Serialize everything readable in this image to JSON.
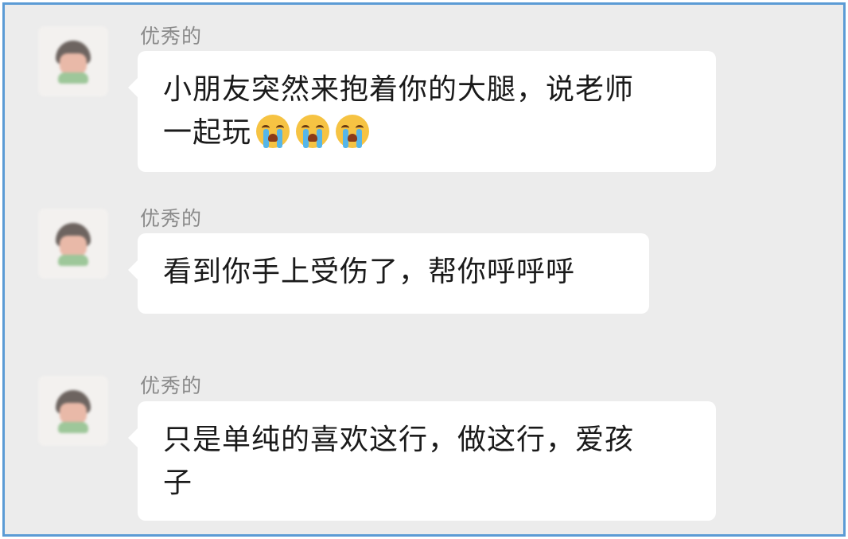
{
  "messages": [
    {
      "sender": "优秀的",
      "text_line1": "小朋友突然来抱着你的大腿，说老师",
      "text_line2": "一起玩",
      "emojis": [
        "crying-face-icon",
        "crying-face-icon",
        "crying-face-icon"
      ]
    },
    {
      "sender": "优秀的",
      "text_line1": "看到你手上受伤了，帮你呼呼呼"
    },
    {
      "sender": "优秀的",
      "text_line1": "只是单纯的喜欢这行，做这行，爱孩",
      "text_line2": "子"
    }
  ]
}
